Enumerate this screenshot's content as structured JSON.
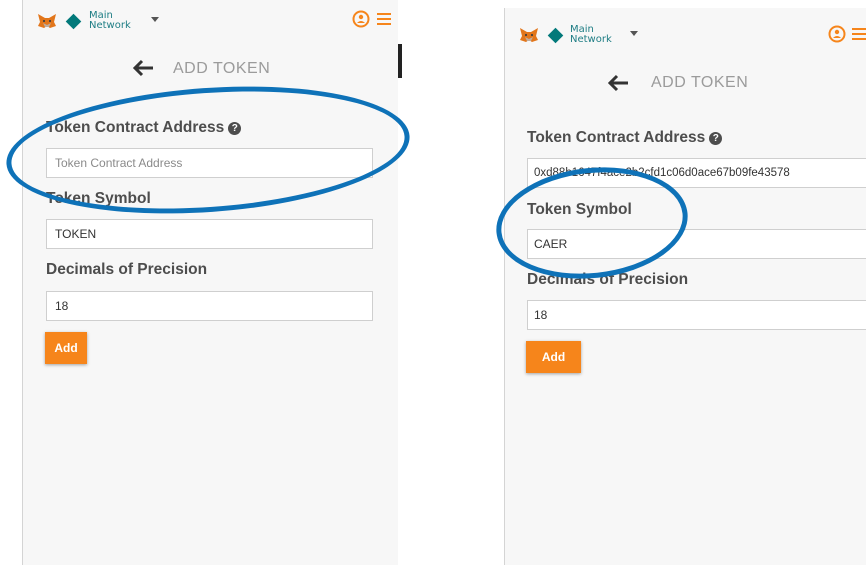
{
  "colors": {
    "accent": "#f6851b",
    "network": "#02797a",
    "annotation": "#0e72b8"
  },
  "left": {
    "network": {
      "line1": "Main",
      "line2": "Network"
    },
    "title": "ADD TOKEN",
    "contract_label": "Token Contract Address",
    "contract_value": "",
    "contract_placeholder": "Token Contract Address",
    "symbol_label": "Token Symbol",
    "symbol_value": "TOKEN",
    "decimals_label": "Decimals of Precision",
    "decimals_value": "18",
    "add_label": "Add"
  },
  "right": {
    "network": {
      "line1": "Main",
      "line2": "Network"
    },
    "title": "ADD TOKEN",
    "contract_label": "Token Contract Address",
    "contract_value": "0xd88b1647f4ace2b2cfd1c06d0ace67b09fe43578",
    "symbol_label": "Token Symbol",
    "symbol_value": "CAER",
    "decimals_label": "Decimals of Precision",
    "decimals_value": "18",
    "add_label": "Add"
  },
  "icons": [
    "metamask-fox-icon",
    "network-diamond-icon",
    "chevron-down-icon",
    "account-icon",
    "hamburger-menu-icon",
    "back-arrow-icon",
    "help-circle-icon"
  ]
}
